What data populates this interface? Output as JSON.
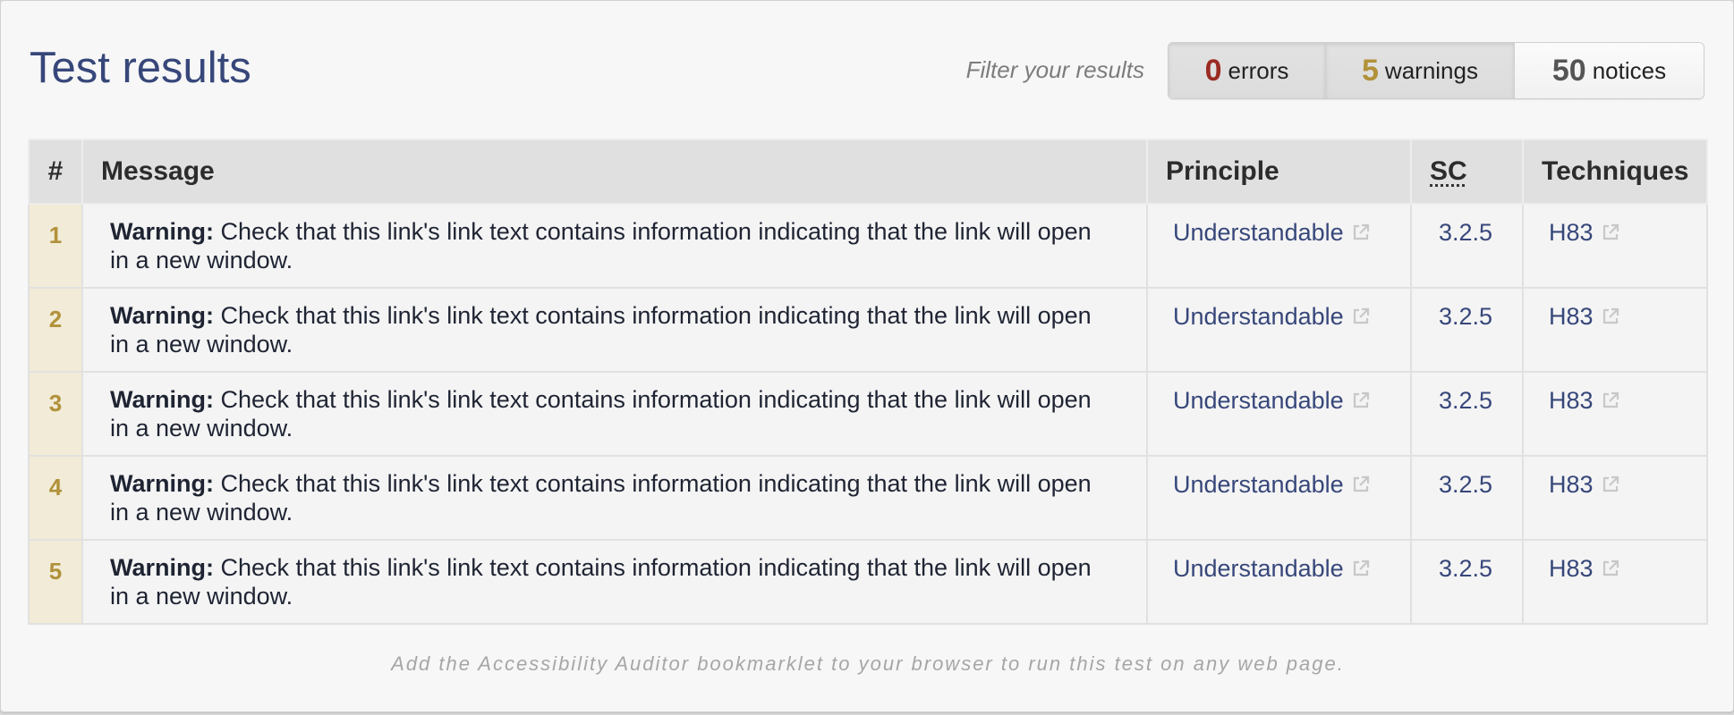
{
  "header": {
    "title": "Test results"
  },
  "filter": {
    "label": "Filter your results",
    "buttons": [
      {
        "count": "0",
        "label": "errors",
        "count_color": "#9a2b22"
      },
      {
        "count": "5",
        "label": "warnings",
        "count_color": "#b1913a"
      },
      {
        "count": "50",
        "label": "notices",
        "count_color": "#555555"
      }
    ]
  },
  "table": {
    "headers": {
      "number": "#",
      "message": "Message",
      "principle": "Principle",
      "sc": "SC",
      "techniques": "Techniques"
    },
    "rows": [
      {
        "num": "1",
        "type": "Warning:",
        "text": "Check that this link's link text contains information indicating that the link will open in a new window.",
        "principle": "Understandable",
        "sc": "3.2.5",
        "technique": "H83"
      },
      {
        "num": "2",
        "type": "Warning:",
        "text": "Check that this link's link text contains information indicating that the link will open in a new window.",
        "principle": "Understandable",
        "sc": "3.2.5",
        "technique": "H83"
      },
      {
        "num": "3",
        "type": "Warning:",
        "text": "Check that this link's link text contains information indicating that the link will open in a new window.",
        "principle": "Understandable",
        "sc": "3.2.5",
        "technique": "H83"
      },
      {
        "num": "4",
        "type": "Warning:",
        "text": "Check that this link's link text contains information indicating that the link will open in a new window.",
        "principle": "Understandable",
        "sc": "3.2.5",
        "technique": "H83"
      },
      {
        "num": "5",
        "type": "Warning:",
        "text": "Check that this link's link text contains information indicating that the link will open in a new window.",
        "principle": "Understandable",
        "sc": "3.2.5",
        "technique": "H83"
      }
    ]
  },
  "footer": {
    "note": "Add the Accessibility Auditor bookmarklet to your browser to run this test on any web page."
  },
  "icons": {
    "external": "external-link-icon"
  },
  "colors": {
    "accent": "#37477a",
    "warning": "#b1913a",
    "error": "#9a2b22"
  }
}
